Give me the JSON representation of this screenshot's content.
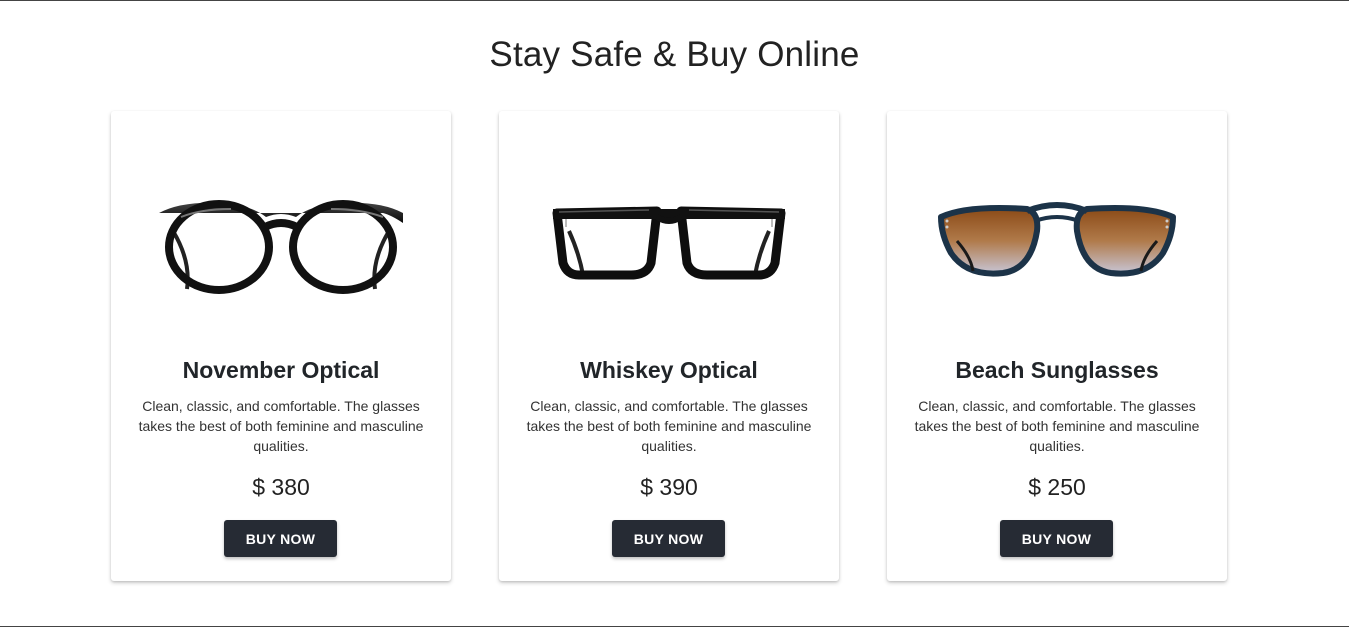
{
  "section": {
    "title": "Stay Safe & Buy Online"
  },
  "products": [
    {
      "name": "November Optical",
      "description": "Clean, classic, and comfortable. The glasses takes the best of both feminine and masculine qualities.",
      "price": "$ 380",
      "button_label": "BUY NOW",
      "image_icon": "round-black-eyeglasses"
    },
    {
      "name": "Whiskey Optical",
      "description": "Clean, classic, and comfortable. The glasses takes the best of both feminine and masculine qualities.",
      "price": "$ 390",
      "button_label": "BUY NOW",
      "image_icon": "rectangular-black-eyeglasses"
    },
    {
      "name": "Beach Sunglasses",
      "description": "Clean, classic, and comfortable. The glasses takes the best of both feminine and masculine qualities.",
      "price": "$ 250",
      "button_label": "BUY NOW",
      "image_icon": "aviator-gradient-sunglasses"
    }
  ],
  "colors": {
    "button_bg": "#262b34",
    "button_text": "#ffffff",
    "text": "#212529",
    "lens_tint_top": "#9a5a22",
    "lens_tint_bottom": "#c9c9d6",
    "sunglass_frame": "#1c3348"
  }
}
